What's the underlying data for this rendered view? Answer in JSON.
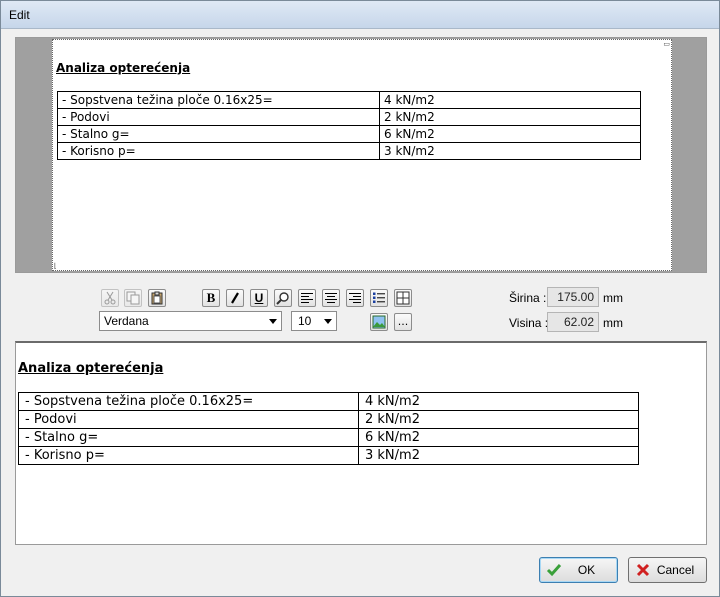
{
  "window": {
    "title": "Edit"
  },
  "content": {
    "heading": "Analiza opterećenja",
    "rows": [
      {
        "label": "- Sopstvena težina ploče  0.16x25=",
        "value": "4 kN/m2"
      },
      {
        "label": "- Podovi",
        "value": "2 kN/m2"
      },
      {
        "label": "- Stalno g=",
        "value": "6 kN/m2"
      },
      {
        "label": "- Korisno p=",
        "value": "3 kN/m2"
      }
    ]
  },
  "toolbar": {
    "font": "Verdana",
    "size": "10",
    "more_label": "..."
  },
  "dimensions": {
    "width_label": "Širina :",
    "width_value": "175.00",
    "width_unit": "mm",
    "height_label": "Visina :",
    "height_value": "62.02",
    "height_unit": "mm"
  },
  "buttons": {
    "ok": "OK",
    "cancel": "Cancel"
  },
  "colors": {
    "ok_check": "#3aa03a",
    "cancel_x": "#d02020"
  }
}
